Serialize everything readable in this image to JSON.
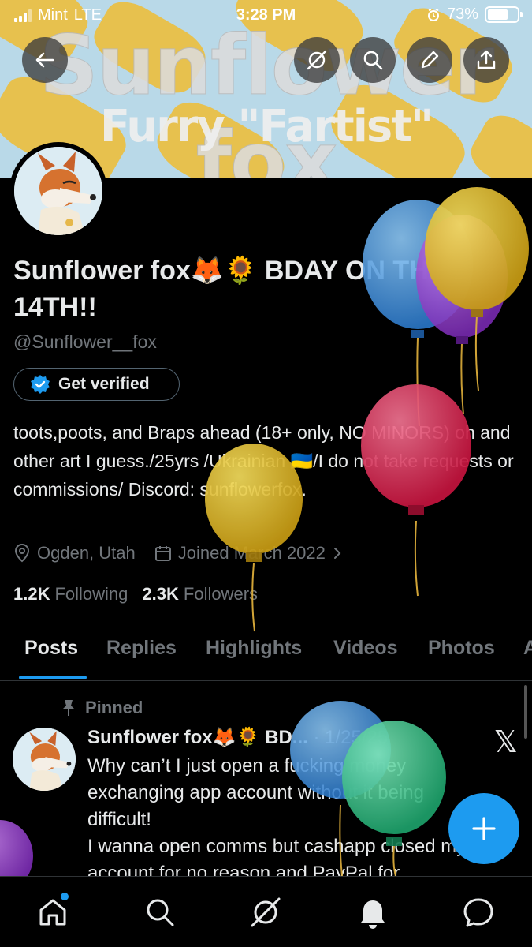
{
  "status_bar": {
    "carrier": "Mint",
    "network": "LTE",
    "time": "3:28 PM",
    "battery": "73%",
    "battery_level": 0.73
  },
  "banner": {
    "title": "Sunflower fox",
    "subtitle": "Furry \"Fartist\"",
    "colors": {
      "sky": "#b9d9e8",
      "yellow": "#e7c14e"
    }
  },
  "header_buttons": {
    "back": "back-arrow-icon",
    "grok": "grok-icon",
    "search": "search-icon",
    "edit": "pencil-icon",
    "share": "share-icon"
  },
  "profile": {
    "display_name": "Sunflower fox🦊🌻 BDAY ON THE 14TH!!",
    "handle": "@Sunflower__fox",
    "verify_button": "Get verified",
    "bio": "toots,poots, and Braps ahead (18+ only, NO MINORS) oh and other art I guess./25yrs /Ukrainian 🇺🇦/I do not take requests or commissions/ Discord: sunflowerfox.",
    "location": "Ogden, Utah",
    "joined": "Joined March 2022",
    "following_count": "1.2K",
    "following_label": "Following",
    "followers_count": "2.3K",
    "followers_label": "Followers"
  },
  "tabs": [
    "Posts",
    "Replies",
    "Highlights",
    "Videos",
    "Photos",
    "A"
  ],
  "pinned_post": {
    "pinned_label": "Pinned",
    "author": "Sunflower fox🦊🌻 BD...",
    "date": "· 1/25/25",
    "lines": [
      "Why can’t I just open a fucking money",
      "exchanging app account without it being",
      "difficult!",
      "I wanna open comms but cashapp closed my",
      "account for no reason and PayPal for"
    ]
  },
  "accent": "#1d9bf0",
  "bottom_nav": [
    "home-icon",
    "search-icon",
    "grok-icon",
    "notifications-icon",
    "messages-icon"
  ]
}
